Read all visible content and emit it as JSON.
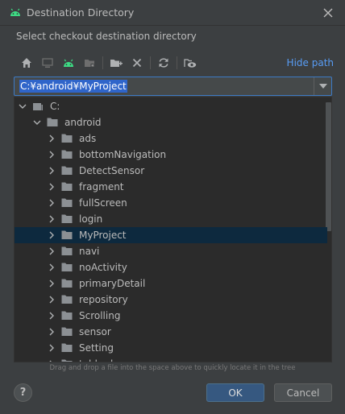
{
  "window": {
    "title": "Destination Directory",
    "icon": "android-icon"
  },
  "prompt": "Select checkout destination directory",
  "toolbar": {
    "buttons": [
      "home-icon",
      "desktop-icon",
      "android-project-icon",
      "module-icon",
      "new-folder-icon",
      "delete-icon",
      "refresh-icon",
      "show-hidden-icon"
    ],
    "hide_path_label": "Hide path"
  },
  "path": {
    "value": "C:¥android¥MyProject"
  },
  "tree": {
    "root": {
      "label": "C:",
      "expanded": true
    },
    "parent": {
      "label": "android",
      "expanded": true
    },
    "children": [
      {
        "label": "ads"
      },
      {
        "label": "bottomNavigation"
      },
      {
        "label": "DetectSensor"
      },
      {
        "label": "fragment"
      },
      {
        "label": "fullScreen"
      },
      {
        "label": "login"
      },
      {
        "label": "MyProject",
        "selected": true
      },
      {
        "label": "navi"
      },
      {
        "label": "noActivity"
      },
      {
        "label": "primaryDetail"
      },
      {
        "label": "repository"
      },
      {
        "label": "Scrolling"
      },
      {
        "label": "sensor"
      },
      {
        "label": "Setting"
      },
      {
        "label": "tabbed"
      }
    ]
  },
  "hint": "Drag and drop a file into the space above to quickly locate it in the tree",
  "buttons": {
    "help": "?",
    "ok": "OK",
    "cancel": "Cancel"
  },
  "colors": {
    "accent": "#589df6",
    "android_green": "#3ddc84",
    "selection": "#0d293e",
    "primary_button": "#365880"
  }
}
